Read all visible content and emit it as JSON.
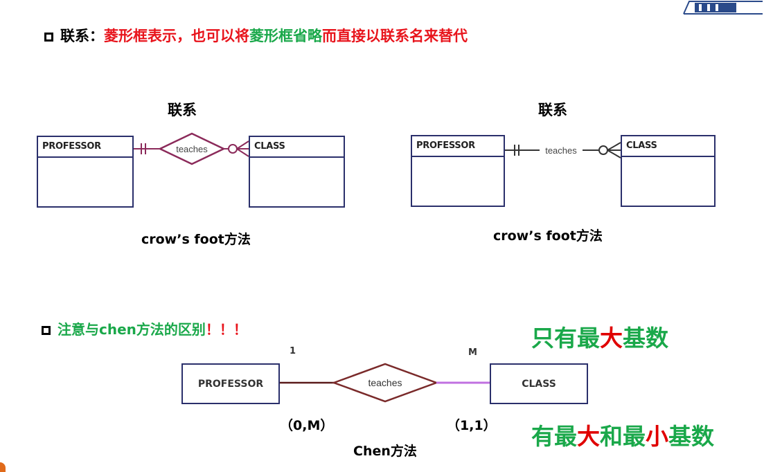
{
  "heading": {
    "bullet_label": "联系：",
    "part_red": "菱形框表示，也可以将",
    "part_green": "菱形框省略",
    "part_red2": "而直接以联系名来替代"
  },
  "diagram_left": {
    "label": "联系",
    "entity_a": "PROFESSOR",
    "entity_b": "CLASS",
    "relationship": "teaches",
    "caption": "crow’s foot方法"
  },
  "diagram_right": {
    "label": "联系",
    "entity_a": "PROFESSOR",
    "entity_b": "CLASS",
    "relationship": "teaches",
    "caption": "crow’s foot方法"
  },
  "note": {
    "text": "注意与chen方法的区别",
    "exclaim": "！！！"
  },
  "chen": {
    "entity_a": "PROFESSOR",
    "entity_b": "CLASS",
    "relationship": "teaches",
    "card_left": "1",
    "card_right": "M",
    "range_left": "（0,M）",
    "range_right": "（1,1）",
    "caption": "Chen方法"
  },
  "callout_top": {
    "part1": "只有最",
    "part2": "大",
    "part3": "基数"
  },
  "callout_bottom": {
    "part1": "有最",
    "part2": "大",
    "part3": "和最",
    "part4": "小",
    "part5": "基数"
  },
  "colors": {
    "red": "#e8141c",
    "green": "#1aa84a",
    "entity_border": "#2a2f6b",
    "diamond": "#8b2a5a",
    "chen_line_left": "#5a1a1a",
    "chen_line_right": "#c070e0"
  }
}
